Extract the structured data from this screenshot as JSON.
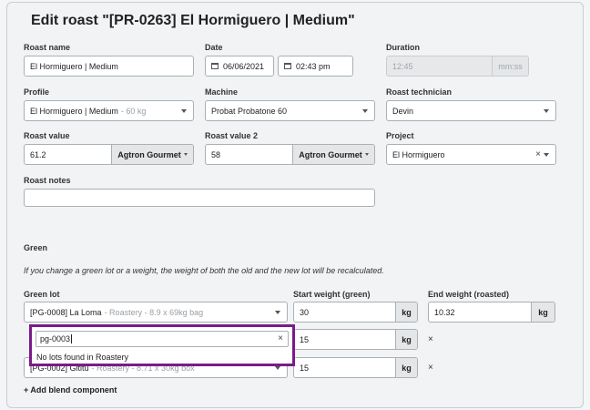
{
  "page_title": "Edit roast \"[PR-0263] El Hormiguero | Medium\"",
  "roast_name": {
    "label": "Roast name",
    "value": "El Hormiguero | Medium"
  },
  "date": {
    "label": "Date",
    "date_value": "06/06/2021",
    "time_value": "02:43 pm"
  },
  "duration": {
    "label": "Duration",
    "value": "12:45",
    "unit": "mm:ss"
  },
  "profile": {
    "label": "Profile",
    "value": "El Hormiguero | Medium",
    "hint": "- 60 kg"
  },
  "machine": {
    "label": "Machine",
    "value": "Probat Probatone 60"
  },
  "roast_technician": {
    "label": "Roast technician",
    "value": "Devin"
  },
  "roast_value": {
    "label": "Roast value",
    "value": "61.2",
    "scale": "Agtron Gourmet"
  },
  "roast_value_2": {
    "label": "Roast value 2",
    "value": "58",
    "scale": "Agtron Gourmet"
  },
  "project": {
    "label": "Project",
    "value": "El Hormiguero",
    "clear": "×"
  },
  "roast_notes": {
    "label": "Roast notes",
    "value": ""
  },
  "green": {
    "section_title": "Green",
    "note": "If you change a green lot or a weight, the weight of both the old and the new lot will be recalculated.",
    "green_lot_label": "Green lot",
    "start_weight_label": "Start weight (green)",
    "end_weight_label": "End weight (roasted)",
    "unit": "kg",
    "remove_symbol": "×",
    "rows": [
      {
        "lot": "[PG-0008] La Loma",
        "lot_hint": "- Roastery - 8.9 x 69kg bag",
        "start_weight": "30"
      },
      {
        "lot": "",
        "lot_hint": "",
        "start_weight": "15"
      },
      {
        "lot": "[PG-0002] Gititu",
        "lot_hint": "- Roastery - 8.71 x 30kg box",
        "start_weight": "15"
      }
    ],
    "end_weight": "10.32",
    "add_component": "+ Add blend component"
  },
  "lot_search": {
    "query": "pg-0003",
    "clear": "×",
    "empty_message": "No lots found in Roastery"
  }
}
